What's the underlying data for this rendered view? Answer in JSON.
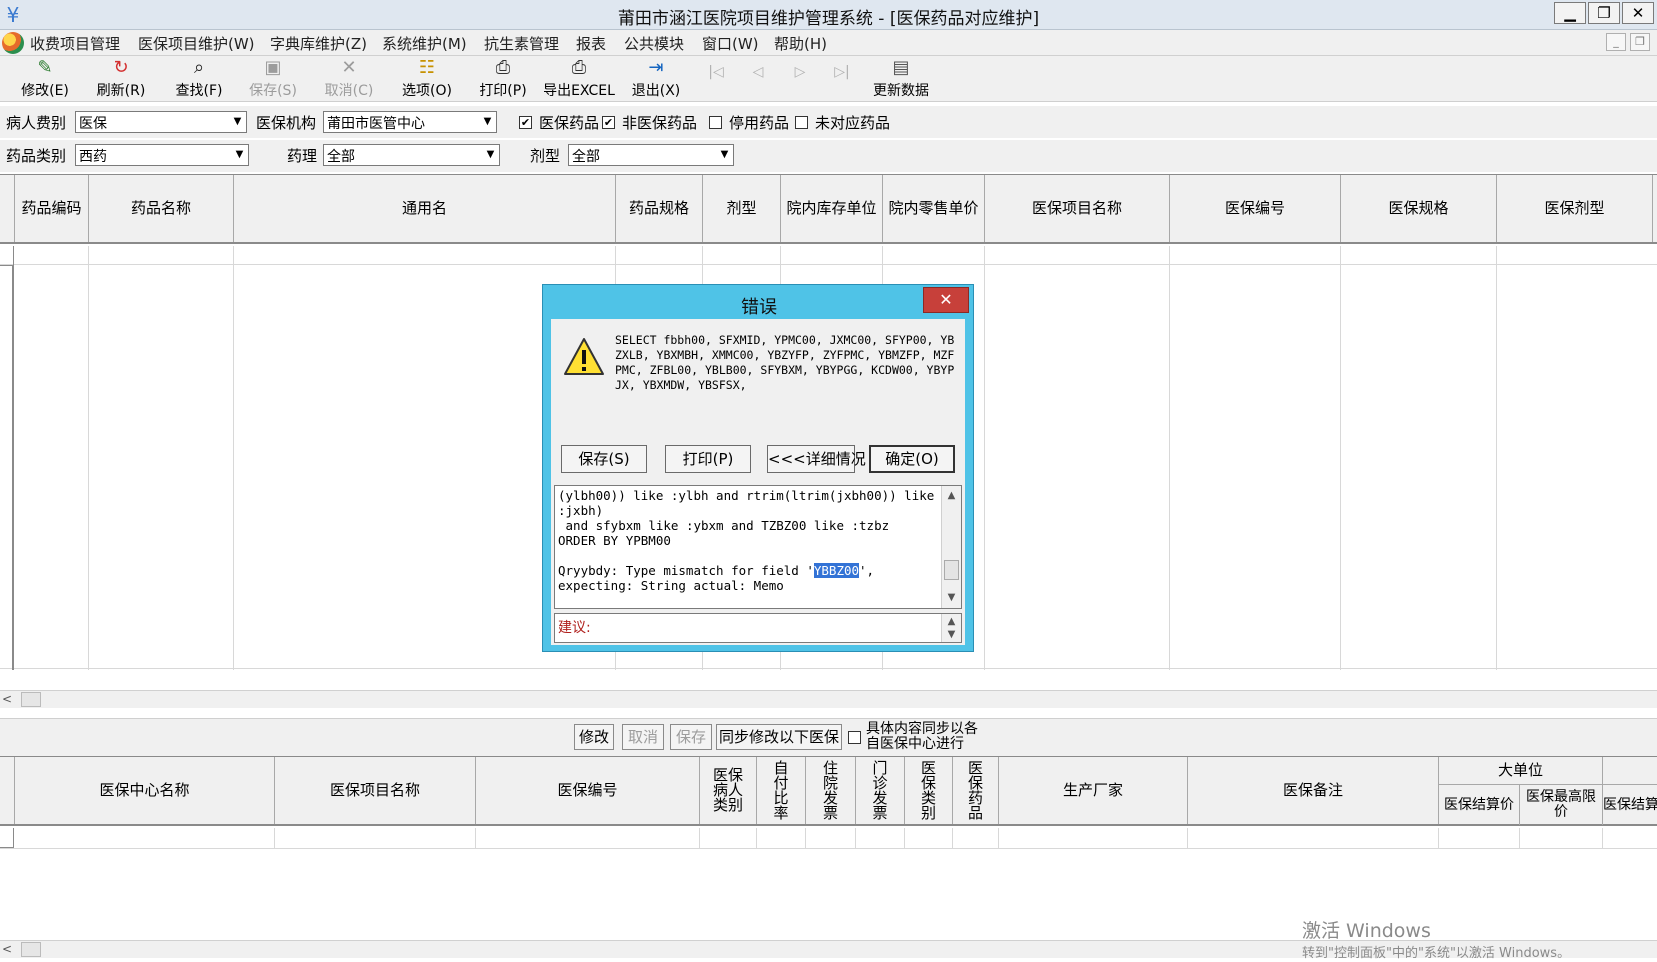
{
  "window": {
    "title": "莆田市涵江医院项目维护管理系统 - [医保药品对应维护]",
    "app_icon": "yen-icon",
    "min": "▁",
    "restore": "❐",
    "close": "✕"
  },
  "menu": {
    "items": [
      "收费项目管理",
      "医保项目维护(W)",
      "字典库维护(Z)",
      "系统维护(M)",
      "抗生素管理",
      "报表",
      "公共模块",
      "窗口(W)",
      "帮助(H)"
    ],
    "mdi_min": "_",
    "mdi_restore": "❐"
  },
  "toolbar": {
    "buttons": [
      {
        "label": "修改(E)",
        "icon": "edit-icon",
        "glyph": "✎",
        "color": "#2e7d32",
        "enabled": true
      },
      {
        "label": "刷新(R)",
        "icon": "refresh-icon",
        "glyph": "↻",
        "color": "#d32f2f",
        "enabled": true
      },
      {
        "label": "查找(F)",
        "icon": "binoculars-icon",
        "glyph": "⌕",
        "color": "#222222",
        "enabled": true
      },
      {
        "label": "保存(S)",
        "icon": "save-icon",
        "glyph": "▣",
        "color": "#9e9e9e",
        "enabled": false
      },
      {
        "label": "取消(C)",
        "icon": "cancel-icon",
        "glyph": "✕",
        "color": "#9e9e9e",
        "enabled": false
      },
      {
        "label": "选项(O)",
        "icon": "options-icon",
        "glyph": "☷",
        "color": "#c79100",
        "enabled": true
      },
      {
        "label": "打印(P)",
        "icon": "printer-icon",
        "glyph": "⎙",
        "color": "#333333",
        "enabled": true
      },
      {
        "label": "导出EXCEL",
        "icon": "export-excel-icon",
        "glyph": "⎙",
        "color": "#333333",
        "enabled": true
      },
      {
        "label": "退出(X)",
        "icon": "exit-icon",
        "glyph": "⇥",
        "color": "#1565c0",
        "enabled": true
      }
    ],
    "nav": [
      "|◁",
      "◁",
      "▷",
      "▷|"
    ],
    "update_label": "更新数据",
    "update_icon": "update-data-icon"
  },
  "filters": {
    "patient_type_label": "病人费别",
    "patient_type_value": "医保",
    "institution_label": "医保机构",
    "institution_value": "莆田市医管中心",
    "chk_insured_label": "医保药品",
    "chk_insured": "✔",
    "chk_non_insured_label": "非医保药品",
    "chk_non_insured": "✔",
    "chk_disabled_label": "停用药品",
    "chk_disabled": "",
    "chk_unmatched_label": "未对应药品",
    "chk_unmatched": "",
    "drug_category_label": "药品类别",
    "drug_category_value": "西药",
    "pharmacology_label": "药理",
    "pharmacology_value": "全部",
    "dosage_form_label": "剂型",
    "dosage_form_value": "全部"
  },
  "top_grid": {
    "columns": [
      "药品编码",
      "药品名称",
      "通用名",
      "药品规格",
      "剂型",
      "院内库存单位",
      "院内零售单价",
      "医保项目名称",
      "医保编号",
      "医保规格",
      "医保剂型"
    ]
  },
  "mid_bar": {
    "edit": "修改",
    "cancel": "取消",
    "save": "保存",
    "sync": "同步修改以下医保",
    "chk_label_1": "具体内容同步以各",
    "chk_label_2": "自医保中心进行"
  },
  "bottom_grid": {
    "columns": [
      "医保中心名称",
      "医保项目名称",
      "医保编号",
      "医保病人类别",
      "自付比率",
      "住院发票",
      "门诊发票",
      "医保类别",
      "医保药品",
      "生产厂家",
      "医保备注"
    ],
    "group_header": "大单位",
    "group_columns": [
      "医保结算价",
      "医保最高限价",
      "医保结算价"
    ]
  },
  "dialog": {
    "title": "错误",
    "close": "✕",
    "message": "SELECT fbbh00, SFXMID, YPMC00, JXMC00, SFYP00, YBZXLB, YBXMBH, XMMC00, YBZYFP, ZYFPMC, YBMZFP, MZFPMC, ZFBL00, YBLB00, SFYBXM, YBYPGG, KCDW00, YBYPJX, YBXMDW, YBSFSX,",
    "buttons": {
      "save": "保存(S)",
      "print": "打印(P)",
      "details": "<<<详细情况",
      "ok": "确定(O)"
    },
    "detail_pre": "(ylbh00)) like :ylbh and rtrim(ltrim(jxbh00)) like :jxbh)\n and sfybxm like :ybxm and TZBZ00 like :tzbz\nORDER BY YPBM00\n\nQryybdy: Type mismatch for field '",
    "detail_highlight": "YBBZ00",
    "detail_post": "',\nexpecting: String actual: Memo",
    "suggest_label": "建议:"
  },
  "watermark": {
    "line1": "激活 Windows",
    "line2": "转到\"控制面板\"中的\"系统\"以激活 Windows。"
  }
}
